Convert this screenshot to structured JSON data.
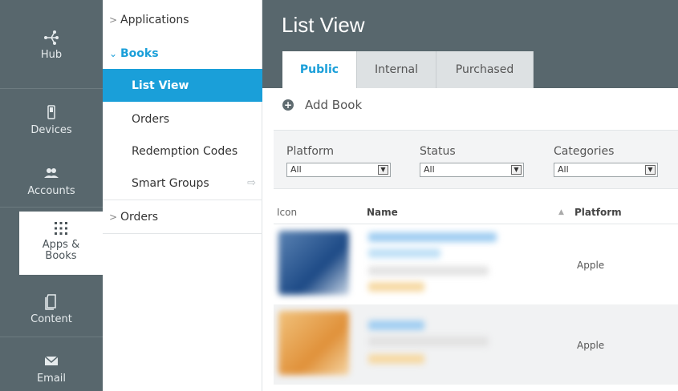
{
  "rail": {
    "items": [
      {
        "label": "Hub",
        "icon": "hub-icon"
      },
      {
        "label": "Devices",
        "icon": "devices-icon"
      },
      {
        "label": "Accounts",
        "icon": "accounts-icon"
      },
      {
        "label": "Apps &\nBooks",
        "icon": "apps-grid-icon"
      },
      {
        "label": "Content",
        "icon": "content-icon"
      },
      {
        "label": "Email",
        "icon": "email-icon"
      }
    ]
  },
  "subnav": {
    "applications": "Applications",
    "books": "Books",
    "list_view": "List View",
    "orders": "Orders",
    "redemption_codes": "Redemption Codes",
    "smart_groups": "Smart Groups",
    "orders_top": "Orders"
  },
  "header": {
    "title": "List View",
    "tabs": [
      "Public",
      "Internal",
      "Purchased"
    ]
  },
  "toolbar": {
    "add_book": "Add Book"
  },
  "filters": {
    "platform": {
      "label": "Platform",
      "value": "All"
    },
    "status": {
      "label": "Status",
      "value": "All"
    },
    "categories": {
      "label": "Categories",
      "value": "All"
    }
  },
  "table": {
    "columns": [
      "Icon",
      "Name",
      "Platform"
    ],
    "rows": [
      {
        "platform": "Apple"
      },
      {
        "platform": "Apple"
      }
    ]
  },
  "colors": {
    "accent": "#1a9fd9",
    "rail": "#58676d"
  }
}
